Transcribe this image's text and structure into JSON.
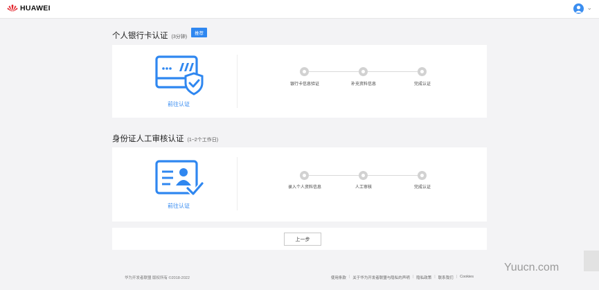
{
  "header": {
    "brand": "HUAWEI"
  },
  "sections": [
    {
      "title": "个人银行卡认证",
      "subtitle": "(3分钟)",
      "badge": "推荐",
      "link": "前往认证",
      "steps": [
        "银行卡信息验证",
        "补充资料信息",
        "完成认证"
      ]
    },
    {
      "title": "身份证人工审核认证",
      "subtitle": "(1~2个工作日)",
      "link": "前往认证",
      "steps": [
        "录入个人资料信息",
        "人工审核",
        "完成认证"
      ]
    }
  ],
  "nav": {
    "prev_label": "上一步"
  },
  "footer": {
    "copyright": "华为开发者联盟 版权所有 ©2018-2022",
    "links": [
      "使用条款",
      "关于华为开发者联盟与隐私的声明",
      "隐私政策",
      "联系我们",
      "Cookies"
    ]
  },
  "watermark": "Yuucn.com",
  "colors": {
    "accent": "#2f87f0",
    "brand_red": "#e3232b"
  },
  "icons": {
    "bank_card": "bank-card-shield-icon",
    "id_card": "id-card-check-icon"
  }
}
